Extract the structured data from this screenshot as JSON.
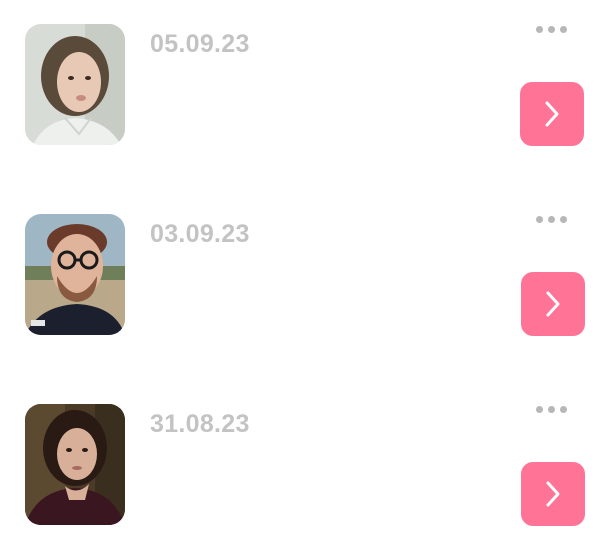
{
  "entries": [
    {
      "date": "05.09.23",
      "avatar_icon": "person-photo",
      "more_icon": "more-dots-icon",
      "action_icon": "chevron-right-icon"
    },
    {
      "date": "03.09.23",
      "avatar_icon": "person-photo",
      "more_icon": "more-dots-icon",
      "action_icon": "chevron-right-icon"
    },
    {
      "date": "31.08.23",
      "avatar_icon": "person-photo",
      "more_icon": "more-dots-icon",
      "action_icon": "chevron-right-icon"
    }
  ],
  "colors": {
    "accent": "#ff7396",
    "date_text": "#c3c3c3",
    "dots": "#b7b7b7",
    "background": "#ffffff"
  }
}
